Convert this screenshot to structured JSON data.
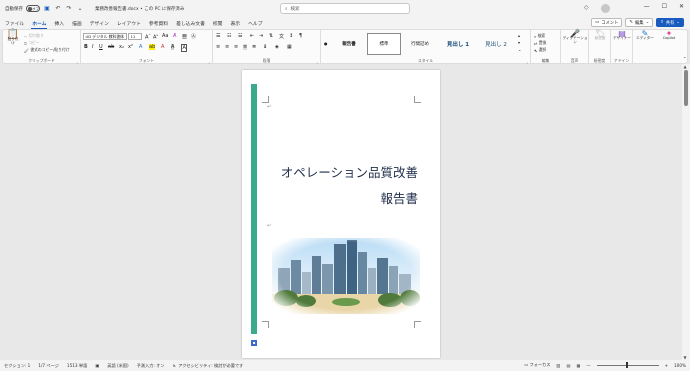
{
  "titlebar": {
    "autosave_label": "自動保存",
    "autosave_state": "オフ",
    "doc_title": "業務改善報告書.docx • この PC に保存済み",
    "search_placeholder": "検索"
  },
  "tabs": [
    "ファイル",
    "ホーム",
    "挿入",
    "描画",
    "デザイン",
    "レイアウト",
    "参考資料",
    "差し込み文書",
    "校閲",
    "表示",
    "ヘルプ"
  ],
  "active_tab": "ホーム",
  "tab_buttons": {
    "comment": "コメント",
    "edit": "編集",
    "share": "共有"
  },
  "ribbon": {
    "clipboard": {
      "paste": "貼り付け",
      "cut": "切り取り",
      "copy": "コピー",
      "format_painter": "書式のコピー/貼り付け",
      "label": "クリップボード"
    },
    "font": {
      "font_name": "UD デジタル 教科書体",
      "font_size": "11",
      "label": "フォント"
    },
    "paragraph": {
      "label": "段落"
    },
    "styles": {
      "items": [
        "報告書",
        "標準",
        "行間詰め",
        "見出し 1",
        "見出し 2"
      ],
      "selected": "標準",
      "label": "スタイル"
    },
    "editing": {
      "find": "検索",
      "replace": "置換",
      "select": "選択",
      "label": "編集"
    },
    "voice": {
      "dictate": "ディクテーション",
      "label": "音声"
    },
    "sensitivity": {
      "button": "秘密度",
      "label": "秘密度"
    },
    "designer": {
      "button": "デザイナー",
      "label": "アドイン"
    },
    "copilot": {
      "editor": "エディター",
      "copilot": "Copilot"
    }
  },
  "document": {
    "title_line1": "オペレーション品質改善",
    "title_line2": "報告書",
    "colors": {
      "accent_bar": "#3aa98c",
      "title_text": "#1f2d4a",
      "brand": "#185abd"
    }
  },
  "statusbar": {
    "section": "セクション: 1",
    "page": "1/7 ページ",
    "words": "1513 単語",
    "language": "英語 (米国)",
    "predict": "予測入力: オン",
    "accessibility": "アクセシビリティ: 検討が必要です",
    "focus": "フォーカス",
    "zoom": "100%"
  }
}
